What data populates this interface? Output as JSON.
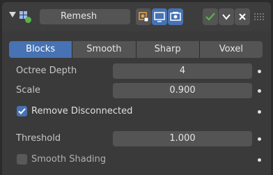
{
  "header": {
    "name": "Remesh",
    "icons": [
      "expand-arrow-icon",
      "remesh-modifier-icon",
      "edit-cage-icon",
      "viewport-icon",
      "render-icon",
      "apply-check-icon",
      "dropdown-chevron-icon",
      "close-icon",
      "drag-grip-icon"
    ],
    "colors": {
      "active": "#4772b3",
      "apply": "#5ab34a"
    }
  },
  "mode_tabs": [
    {
      "label": "Blocks",
      "active": true
    },
    {
      "label": "Smooth",
      "active": false
    },
    {
      "label": "Sharp",
      "active": false
    },
    {
      "label": "Voxel",
      "active": false
    }
  ],
  "fields": {
    "octree_depth": {
      "label": "Octree Depth",
      "value": "4"
    },
    "scale": {
      "label": "Scale",
      "value": "0.900"
    },
    "remove_disconnected": {
      "label": "Remove Disconnected",
      "checked": true
    },
    "threshold": {
      "label": "Threshold",
      "value": "1.000"
    },
    "smooth_shading": {
      "label": "Smooth Shading",
      "checked": false
    }
  }
}
